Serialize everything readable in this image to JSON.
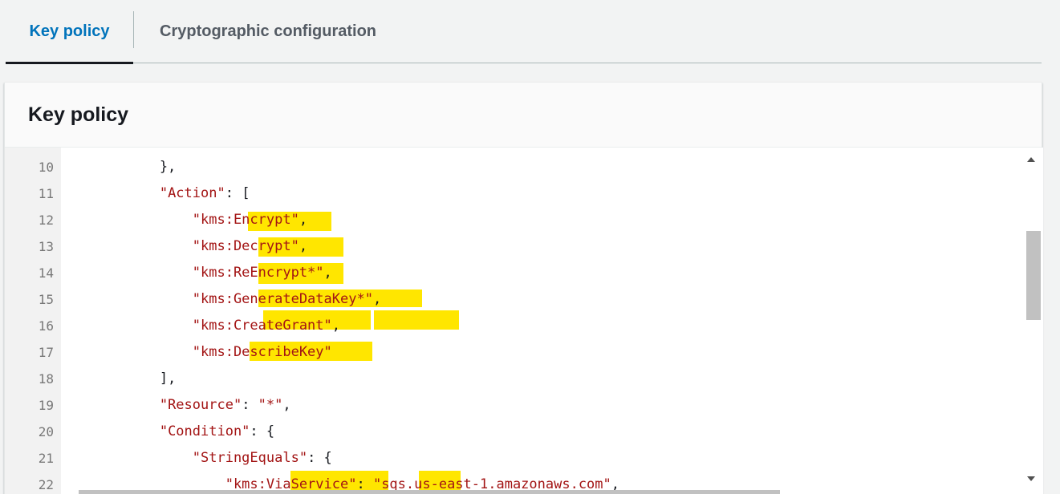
{
  "tabs": {
    "key_policy": "Key policy",
    "crypto_config": "Cryptographic configuration"
  },
  "panel": {
    "title": "Key policy"
  },
  "editor": {
    "lines": [
      {
        "num": "10",
        "text": "            },"
      },
      {
        "num": "11",
        "text": "            \"Action\": ["
      },
      {
        "num": "12",
        "text": "                \"kms:Encrypt\","
      },
      {
        "num": "13",
        "text": "                \"kms:Decrypt\","
      },
      {
        "num": "14",
        "text": "                \"kms:ReEncrypt*\","
      },
      {
        "num": "15",
        "text": "                \"kms:GenerateDataKey*\","
      },
      {
        "num": "16",
        "text": "                \"kms:CreateGrant\","
      },
      {
        "num": "17",
        "text": "                \"kms:DescribeKey\""
      },
      {
        "num": "18",
        "text": "            ],"
      },
      {
        "num": "19",
        "text": "            \"Resource\": \"*\","
      },
      {
        "num": "20",
        "text": "            \"Condition\": {"
      },
      {
        "num": "21",
        "text": "                \"StringEquals\": {"
      },
      {
        "num": "22",
        "text": "                    \"kms:ViaService\": \"sqs.us-east-1.amazonaws.com\","
      }
    ],
    "highlight_color": "#ffe600"
  },
  "colors": {
    "accent": "#0073bb",
    "string": "#a31515",
    "text": "#16191f"
  }
}
